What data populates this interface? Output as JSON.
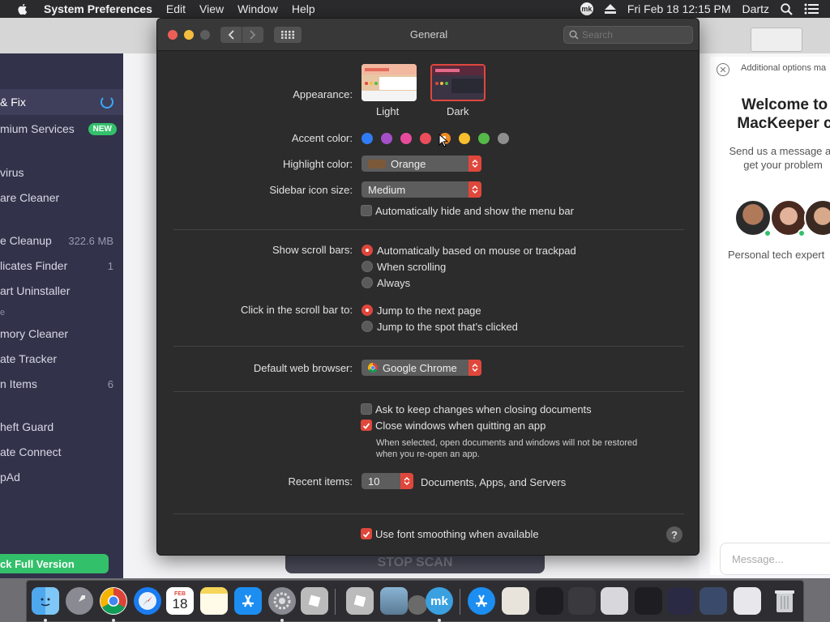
{
  "menubar": {
    "app_name": "System Preferences",
    "items": [
      "Edit",
      "View",
      "Window",
      "Help"
    ],
    "badge": "mk",
    "datetime": "Fri Feb 18  12:15 PM",
    "user": "Dartz"
  },
  "mackeeper": {
    "sidebar": [
      {
        "label": "& Fix"
      },
      {
        "label": "mium Services",
        "badge": "NEW"
      },
      {
        "label": "virus"
      },
      {
        "label": "are Cleaner"
      },
      {
        "label": "e Cleanup",
        "value": "322.6 MB"
      },
      {
        "label": "licates Finder",
        "value": "1"
      },
      {
        "label": "art Uninstaller"
      },
      {
        "label": "mory Cleaner"
      },
      {
        "label": "ate Tracker"
      },
      {
        "label": "n Items",
        "value": "6"
      },
      {
        "label": "heft Guard"
      },
      {
        "label": "ate Connect"
      },
      {
        "label": "pAd"
      }
    ],
    "section_letter": "e",
    "unlock_label": "ck Full Version",
    "stop_scan_label": "STOP SCAN"
  },
  "chat": {
    "note": "Additional options ma",
    "title_line1": "Welcome to",
    "title_line2": "MacKeeper c",
    "sub_line1": "Send us a message an",
    "sub_line2": "get your problem",
    "expert_label": "Personal tech expert",
    "input_placeholder": "Message..."
  },
  "prefs": {
    "window_title": "General",
    "search_placeholder": "Search",
    "appearance": {
      "label": "Appearance:",
      "light_label": "Light",
      "dark_label": "Dark",
      "selected": "Dark"
    },
    "accent": {
      "label": "Accent color:",
      "colors": [
        "#2f7cf6",
        "#a550c8",
        "#e84b9c",
        "#ec4d5a",
        "#f08a24",
        "#f7bf2d",
        "#54b948",
        "#8e8e8e"
      ],
      "selected_index": 4
    },
    "highlight": {
      "label": "Highlight color:",
      "value": "Orange"
    },
    "sidebar_icon": {
      "label": "Sidebar icon size:",
      "value": "Medium"
    },
    "autohide_menu": {
      "label": "Automatically hide and show the menu bar",
      "checked": false
    },
    "scroll_bars": {
      "label": "Show scroll bars:",
      "options": [
        "Automatically based on mouse or trackpad",
        "When scrolling",
        "Always"
      ],
      "selected_index": 0
    },
    "click_scroll": {
      "label": "Click in the scroll bar to:",
      "options": [
        "Jump to the next page",
        "Jump to the spot that’s clicked"
      ],
      "selected_index": 0
    },
    "browser": {
      "label": "Default web browser:",
      "value": "Google Chrome"
    },
    "ask_keep": {
      "label": "Ask to keep changes when closing documents",
      "checked": false
    },
    "close_windows": {
      "label": "Close windows when quitting an app",
      "checked": true,
      "note_line1": "When selected, open documents and windows will not be restored",
      "note_line2": "when you re-open an app."
    },
    "recent": {
      "label": "Recent items:",
      "value": "10",
      "suffix": "Documents, Apps, and Servers"
    },
    "font_smoothing": {
      "label": "Use font smoothing when available",
      "checked": true
    },
    "help": "?"
  },
  "dock": {
    "calendar_month": "FEB",
    "calendar_day": "18",
    "mk_label": "mk"
  },
  "colors": {
    "accent_red": "#e0473c",
    "window_bg": "#2c2c2c",
    "mk_sidebar": "#32324a",
    "mk_green": "#33c06b"
  }
}
